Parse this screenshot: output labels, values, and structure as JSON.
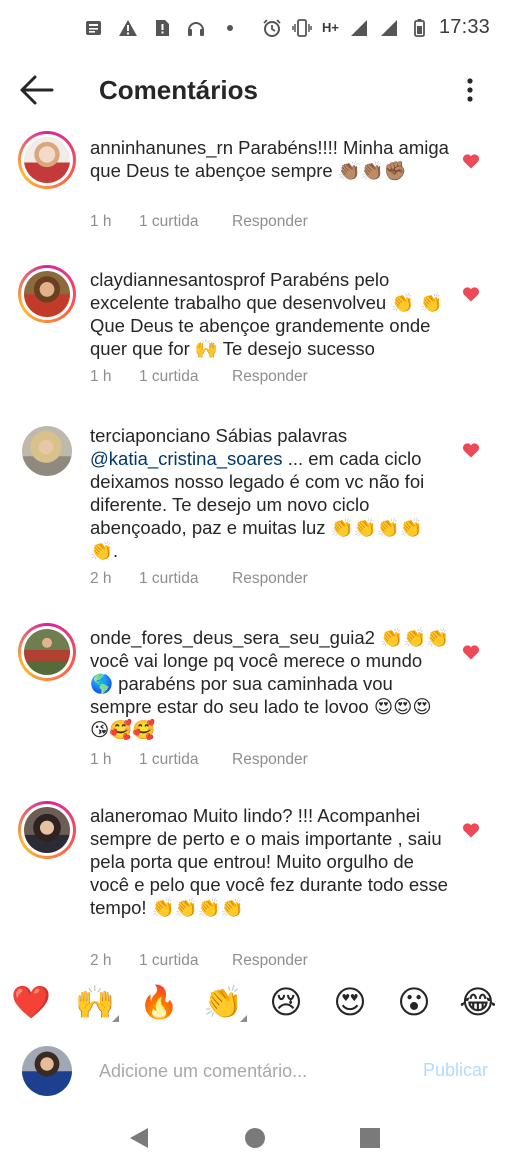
{
  "status_bar": {
    "time": "17:33",
    "network": "H+",
    "left_icons": [
      "news-icon",
      "warning-icon",
      "sim-alert-icon",
      "headphones-icon",
      "dot-icon"
    ],
    "right_icons": [
      "alarm-icon",
      "vibrate-icon",
      "signal-icon",
      "signal-icon",
      "battery-icon"
    ]
  },
  "header": {
    "title": "Comentários",
    "back_icon": "arrow-left-icon",
    "more_icon": "more-vertical-icon"
  },
  "comments": [
    {
      "username": "anninhanunes_rn",
      "text": "Parabéns!!!! Minha amiga que Deus te abençoe sempre 👏🏽👏🏽✊🏽",
      "time": "1 h",
      "likes": "1 curtida",
      "reply": "Responder",
      "avatar_color": "#e9d7cf",
      "ring": true
    },
    {
      "username": "claydiannesantosprof",
      "text": "Parabéns pelo excelente trabalho que desenvolveu 👏 👏 Que Deus te abençoe grandemente onde quer que for 🙌 Te desejo sucesso",
      "time": "1 h",
      "likes": "1 curtida",
      "reply": "Responder",
      "avatar_color": "#b58a52",
      "ring": true
    },
    {
      "username": "terciaponciano",
      "text_before": "Sábias palavras ",
      "mention": "@katia_cristina_soares",
      "text_after": " ... em cada ciclo deixamos nosso legado é com vc não foi diferente. Te desejo um novo ciclo abençoado, paz e muitas luz 👏👏👏👏👏.",
      "time": "2 h",
      "likes": "1 curtida",
      "reply": "Responder",
      "avatar_color": "#c9bfae",
      "ring": false
    },
    {
      "username": "onde_fores_deus_sera_seu_guia2",
      "text": "👏👏👏 você vai longe pq você merece o mundo 🌎 parabéns por sua caminhada vou sempre estar do seu lado te lovoo 😍😍😍😘🥰🥰",
      "time": "1 h",
      "likes": "1 curtida",
      "reply": "Responder",
      "avatar_color": "#7c8a5a",
      "ring": true
    },
    {
      "username": "alaneromao",
      "text": "Muito lindo? !!! Acompanhei sempre de perto e o mais importante , saiu pela porta que entrou! Muito orgulho de você e pelo que você fez durante todo esse tempo! 👏👏👏👏",
      "time": "2 h",
      "likes": "1 curtida",
      "reply": "Responder",
      "avatar_color": "#5a4a45",
      "ring": true
    }
  ],
  "emoji_bar": [
    "❤️",
    "🙌",
    "🔥",
    "👏",
    "😢",
    "😍",
    "😮",
    "😂"
  ],
  "composer": {
    "placeholder": "Adicione um comentário...",
    "publish_label": "Publicar"
  },
  "colors": {
    "heart": "#ed4956",
    "meta": "#8e8e8e",
    "mention": "#00376b",
    "publish_disabled": "#b3dbff"
  }
}
